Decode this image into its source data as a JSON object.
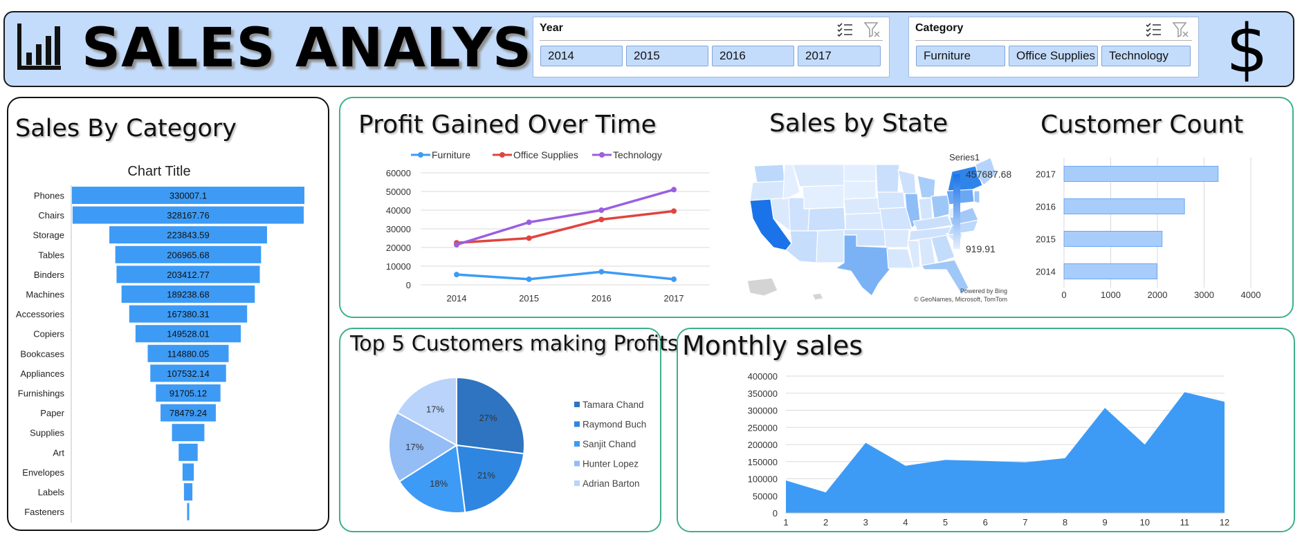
{
  "header": {
    "title": "SALES ANALYSIS",
    "logo_icon": "bar-chart-icon",
    "currency_icon": "dollar-icon",
    "currency_symbol": "$"
  },
  "slicers": {
    "year": {
      "title": "Year",
      "items": [
        "2014",
        "2015",
        "2016",
        "2017"
      ],
      "multiselect_icon": "multi-select-icon",
      "clear_icon": "clear-filter-icon"
    },
    "category": {
      "title": "Category",
      "items": [
        "Furniture",
        "Office Supplies",
        "Technology"
      ],
      "multiselect_icon": "multi-select-icon",
      "clear_icon": "clear-filter-icon"
    }
  },
  "panels": {
    "sales_by_category": "Sales By Category",
    "profit_over_time": "Profit Gained Over Time",
    "sales_by_state": "Sales by State",
    "customer_count": "Customer Count",
    "top5": "Top 5 Customers making Profits",
    "monthly": "Monthly sales"
  },
  "map": {
    "legend_title": "Series1",
    "max_label": "457687.68",
    "min_label": "919.91",
    "credit_line1": "Powered by Bing",
    "credit_line2": "© GeoNames, Microsoft, TomTom",
    "colors": {
      "high": "#1a73e8",
      "low": "#e3efff"
    }
  },
  "colors": {
    "accent": "#3d9bf5",
    "header_bg": "#c4dcfb",
    "panel_border": "#3daf8c"
  },
  "chart_data": [
    {
      "id": "sales_by_category",
      "type": "bar",
      "orientation": "horizontal-funnel",
      "title": "Chart Title",
      "categories": [
        "Phones",
        "Chairs",
        "Storage",
        "Tables",
        "Binders",
        "Machines",
        "Accessories",
        "Copiers",
        "Bookcases",
        "Appliances",
        "Furnishings",
        "Paper",
        "Supplies",
        "Art",
        "Envelopes",
        "Labels",
        "Fasteners"
      ],
      "values": [
        330007.1,
        328167.76,
        223843.59,
        206965.68,
        203412.77,
        189238.68,
        167380.31,
        149528.01,
        114880.05,
        107532.14,
        91705.12,
        78479.24,
        46000,
        27000,
        16000,
        12000,
        3000
      ],
      "data_labels": [
        "330007.1",
        "328167.76",
        "223843.59",
        "206965.68",
        "203412.77",
        "189238.68",
        "167380.31",
        "149528.01",
        "114880.05",
        "107532.14",
        "91705.12",
        "78479.24",
        "",
        "",
        "",
        "",
        ""
      ],
      "color": "#3d9bf5"
    },
    {
      "id": "profit_over_time",
      "type": "line",
      "categories": [
        "2014",
        "2015",
        "2016",
        "2017"
      ],
      "series": [
        {
          "name": "Furniture",
          "values": [
            5500,
            3000,
            7000,
            3000
          ],
          "color": "#3d9bf5"
        },
        {
          "name": "Office Supplies",
          "values": [
            22500,
            25000,
            35000,
            39500
          ],
          "color": "#e0443e"
        },
        {
          "name": "Technology",
          "values": [
            21500,
            33500,
            40000,
            51000
          ],
          "color": "#9b5fe0"
        }
      ],
      "ylim": [
        0,
        60000
      ],
      "yticks": [
        "0",
        "10000",
        "20000",
        "30000",
        "40000",
        "50000",
        "60000"
      ],
      "legend": "top",
      "grid": true
    },
    {
      "id": "customer_count",
      "type": "bar",
      "orientation": "horizontal",
      "categories": [
        "2017",
        "2016",
        "2015",
        "2014"
      ],
      "values": [
        3300,
        2580,
        2100,
        1990
      ],
      "xlim": [
        0,
        4000
      ],
      "xticks": [
        "0",
        "1000",
        "2000",
        "3000",
        "4000"
      ],
      "color": "#a8cdfa"
    },
    {
      "id": "top5_customers",
      "type": "pie",
      "labels": [
        "Tamara Chand",
        "Raymond Buch",
        "Sanjit Chand",
        "Hunter Lopez",
        "Adrian Barton"
      ],
      "values": [
        27,
        21,
        18,
        17,
        17
      ],
      "value_labels": [
        "27%",
        "21%",
        "18%",
        "17%",
        "17%"
      ],
      "colors": [
        "#2f74c0",
        "#2f86e0",
        "#3d9bf5",
        "#94bcf5",
        "#b9d3fb"
      ],
      "legend": "right"
    },
    {
      "id": "monthly_sales",
      "type": "area",
      "categories": [
        "1",
        "2",
        "3",
        "4",
        "5",
        "6",
        "7",
        "8",
        "9",
        "10",
        "11",
        "12"
      ],
      "values": [
        95000,
        60000,
        205000,
        138000,
        155000,
        152000,
        148000,
        160000,
        307000,
        200000,
        353000,
        325000
      ],
      "ylim": [
        0,
        400000
      ],
      "yticks": [
        "0",
        "50000",
        "100000",
        "150000",
        "200000",
        "250000",
        "300000",
        "350000",
        "400000"
      ],
      "color": "#3d9bf5",
      "grid": true
    }
  ]
}
